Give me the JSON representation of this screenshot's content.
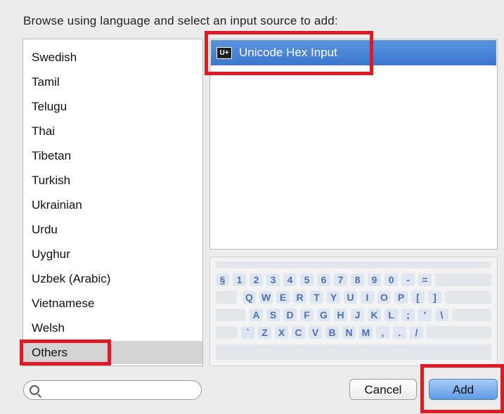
{
  "prompt": "Browse using language and select an input source to add:",
  "languages": [
    "Swedish",
    "Tamil",
    "Telugu",
    "Thai",
    "Tibetan",
    "Turkish",
    "Ukrainian",
    "Urdu",
    "Uyghur",
    "Uzbek (Arabic)",
    "Vietnamese",
    "Welsh",
    "Others"
  ],
  "selected_language": "Others",
  "input_sources": [
    {
      "icon": "U+",
      "label": "Unicode Hex Input",
      "selected": true
    }
  ],
  "keyboard": {
    "row1": [
      "§",
      "1",
      "2",
      "3",
      "4",
      "5",
      "6",
      "7",
      "8",
      "9",
      "0",
      "-",
      "="
    ],
    "row2": [
      "Q",
      "W",
      "E",
      "R",
      "T",
      "Y",
      "U",
      "I",
      "O",
      "P",
      "[",
      "]"
    ],
    "row3": [
      "A",
      "S",
      "D",
      "F",
      "G",
      "H",
      "J",
      "K",
      "L",
      ";",
      "'",
      "\\"
    ],
    "row4": [
      "`",
      "Z",
      "X",
      "C",
      "V",
      "B",
      "N",
      "M",
      ",",
      ".",
      "/"
    ]
  },
  "search": {
    "placeholder": "",
    "value": ""
  },
  "buttons": {
    "cancel": "Cancel",
    "add": "Add"
  },
  "colors": {
    "selection": "#3c77cf",
    "highlight": "#e01a25"
  }
}
